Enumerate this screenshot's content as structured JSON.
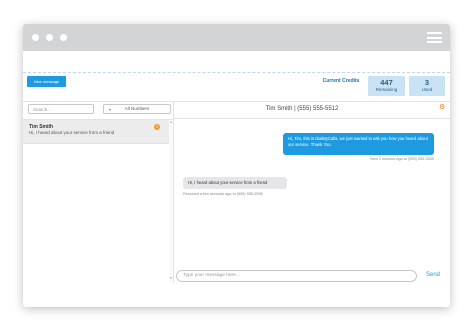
{
  "toolbar": {
    "new_message_label": "New message"
  },
  "credits": {
    "label": "Current Credits",
    "remaining_value": "447",
    "remaining_label": "Remaining",
    "used_value": "3",
    "used_label": "Used"
  },
  "sidebar": {
    "search_placeholder": "Search...",
    "filter_value": "All Numbers",
    "threads": [
      {
        "name": "Tim Smith",
        "preview": "Hi, I heard about your service from a friend",
        "unread": "1"
      }
    ]
  },
  "conversation": {
    "title": "Tim Smith  |  (555) 555-5512",
    "messages": [
      {
        "direction": "outgoing",
        "text": "Hi, Tim, this is DialMyCalls, we just wanted to ask you how you heard about our service. Thank You.",
        "meta": "Sent 2 minutes ago to (555) 555-5555"
      },
      {
        "direction": "incoming",
        "text": "Hi, I heard about your service from a friend",
        "meta": "Received a few seconds ago to (555) 555-5555"
      }
    ],
    "composer_placeholder": "Type your message here...",
    "send_label": "Send"
  },
  "colors": {
    "accent": "#1e9be0",
    "badge": "#f29a2e",
    "gear": "#f07a1a",
    "chrome": "#d3d4d6"
  },
  "icons": [
    "chevron-down-icon",
    "gear-icon",
    "hamburger-menu-icon",
    "window-dot-icon",
    "scroll-arrow-icon"
  ]
}
